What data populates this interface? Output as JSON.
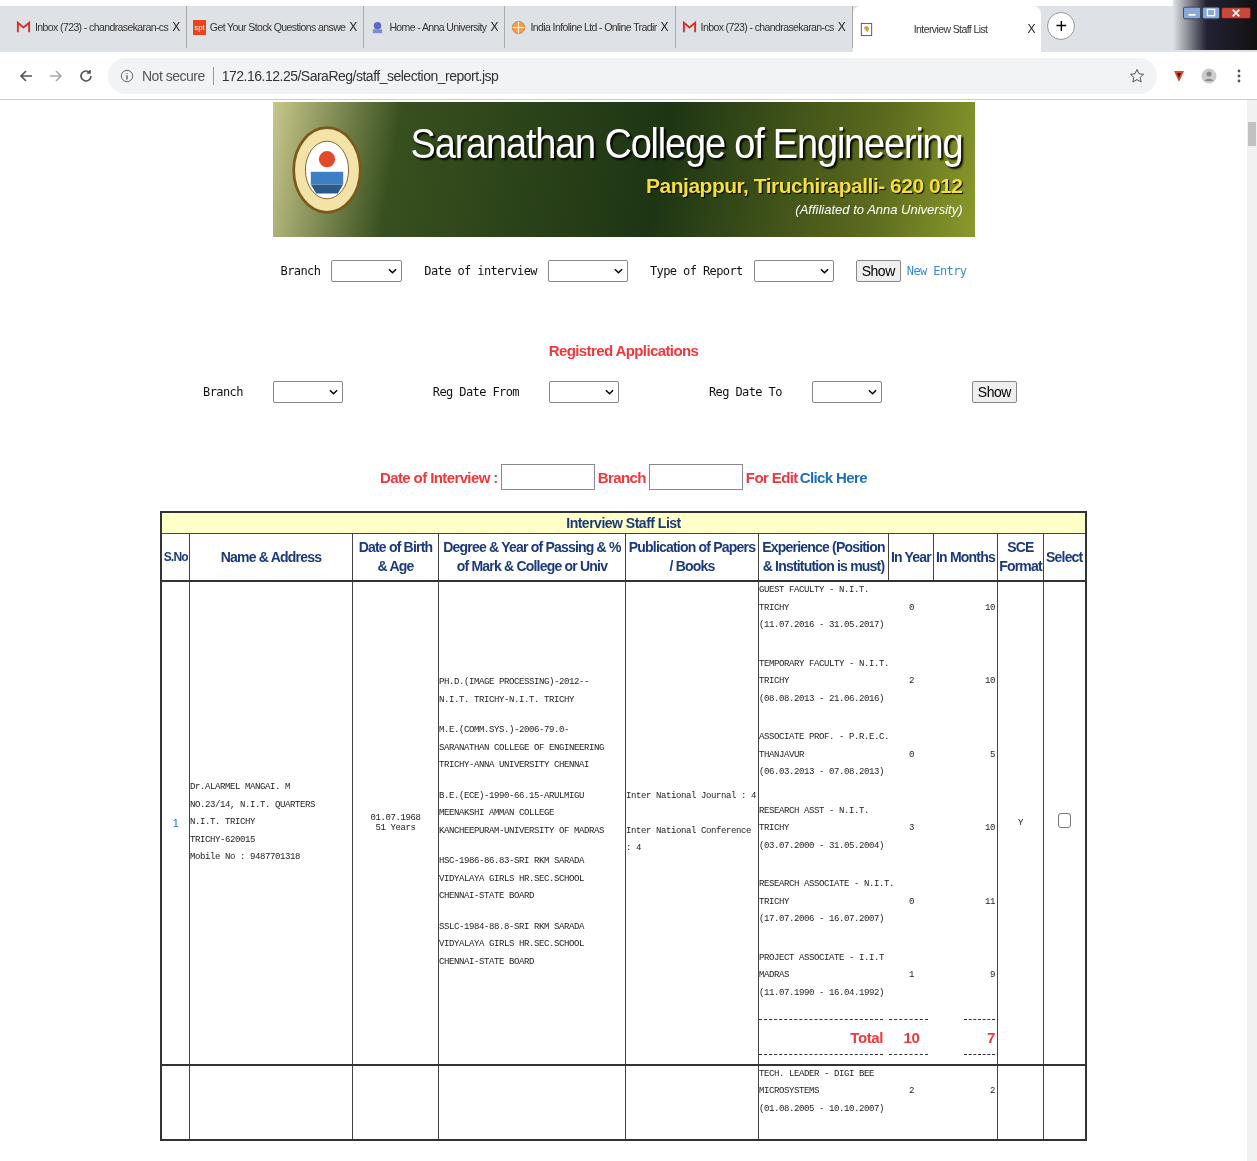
{
  "browser": {
    "tabs": [
      {
        "kind": "gmail",
        "title": "Inbox (723) - chandrasekaran-cs",
        "close": "X",
        "selected": false
      },
      {
        "kind": "text",
        "icon_text": "spt",
        "title": "Get Your Stock Questions answe",
        "close": "X",
        "selected": false
      },
      {
        "kind": "emblem",
        "title": "Home - Anna University",
        "close": "X",
        "selected": false
      },
      {
        "kind": "globe",
        "title": "India Infoline Ltd - Online Tradir",
        "close": "X",
        "selected": false
      },
      {
        "kind": "gmail",
        "title": "Inbox (723) - chandrasekaran-cs",
        "close": "X",
        "selected": false
      },
      {
        "kind": "page",
        "title": "Interview Staff List",
        "close": "X",
        "selected": true
      }
    ],
    "new_tab": "+",
    "address": {
      "security": "Not secure",
      "url": "172.16.12.25/SaraReg/staff_selection_report.jsp"
    }
  },
  "banner": {
    "title": "Saranathan College of Engineering",
    "location": "Panjappur, Tiruchirapalli- 620 012",
    "affiliation": "(Affiliated to Anna University)"
  },
  "filters": {
    "fields": [
      {
        "label": "Branch"
      },
      {
        "label": "Date of interview"
      },
      {
        "label": "Type of Report"
      }
    ],
    "show": "Show",
    "new_entry": "New Entry"
  },
  "registered": {
    "heading": "Registred Applications",
    "fields": [
      {
        "label": "Branch"
      },
      {
        "label": "Reg Date From"
      },
      {
        "label": "Reg Date To"
      }
    ],
    "show": "Show"
  },
  "edit_row": {
    "date_label": "Date of Interview :",
    "branch_label": "Branch",
    "for_edit": "For Edit",
    "click_here": "Click Here"
  },
  "table": {
    "title": "Interview Staff List",
    "columns": [
      "S.No",
      "Name & Address",
      "Date of Birth & Age",
      "Degree & Year of Passing & % of Mark & College or Univ",
      "Publication of Papers / Books",
      "Experience (Position & Institution is must)",
      "In Year",
      "In Months",
      "SCE Format",
      "Select"
    ],
    "rows": [
      {
        "sno": "1",
        "name_lines": [
          "Dr.ALARMEL MANGAI. M",
          "NO.23/14, N.I.T. QUARTERS",
          "N.I.T. TRICHY",
          "TRICHY-620015",
          "Mobile No : 9487701318"
        ],
        "dob": "01.07.1968",
        "age": "51 Years",
        "degrees": [
          [
            "PH.D.(IMAGE PROCESSING)-2012--",
            "N.I.T. TRICHY-N.I.T. TRICHY"
          ],
          [
            "M.E.(COMM.SYS.)-2006-79.0-",
            "SARANATHAN COLLEGE OF ENGINEERING",
            "TRICHY-ANNA UNIVERSITY CHENNAI"
          ],
          [
            "B.E.(ECE)-1990-66.15-ARULMIGU",
            "MEENAKSHI AMMAN COLLEGE",
            "KANCHEEPURAM-UNIVERSITY OF MADRAS"
          ],
          [
            "HSC-1986-86.83-SRI RKM SARADA",
            "VIDYALAYA GIRLS HR.SEC.SCHOOL",
            "CHENNAI-STATE BOARD"
          ],
          [
            "SSLC-1984-88.8-SRI RKM SARADA",
            "VIDYALAYA GIRLS HR.SEC.SCHOOL",
            "CHENNAI-STATE BOARD"
          ]
        ],
        "publications": [
          "Inter National Journal : 4",
          "Inter National Conference : 4"
        ],
        "experience": [
          {
            "position": "GUEST FACULTY - N.I.T.",
            "place": "TRICHY",
            "period": "(11.07.2016 - 31.05.2017)",
            "years": "0",
            "months": "10"
          },
          {
            "position": "TEMPORARY FACULTY - N.I.T.",
            "place": "TRICHY",
            "period": "(08.08.2013 - 21.06.2016)",
            "years": "2",
            "months": "10"
          },
          {
            "position": "ASSOCIATE PROF. - P.R.E.C.",
            "place": "THANJAVUR",
            "period": "(06.03.2013 - 07.08.2013)",
            "years": "0",
            "months": "5"
          },
          {
            "position": "RESEARCH ASST - N.I.T.",
            "place": "TRICHY",
            "period": "(03.07.2000 - 31.05.2004)",
            "years": "3",
            "months": "10"
          },
          {
            "position": "RESEARCH ASSOCIATE - N.I.T.",
            "place": "TRICHY",
            "period": "(17.07.2006 - 16.07.2007)",
            "years": "0",
            "months": "11"
          },
          {
            "position": "PROJECT ASSOCIATE - I.I.T",
            "place": "MADRAS",
            "period": "(11.07.1990 - 16.04.1992)",
            "years": "1",
            "months": "9"
          }
        ],
        "total": {
          "label": "Total",
          "years": "10",
          "months": "7"
        },
        "sce": "Y",
        "selected": false
      },
      {
        "experience": [
          {
            "position": "TECH. LEADER - DIGI BEE",
            "place": "MICROSYSTEMS",
            "period": "(01.08.2005 - 10.10.2007)",
            "years": "2",
            "months": "2"
          }
        ]
      }
    ]
  }
}
